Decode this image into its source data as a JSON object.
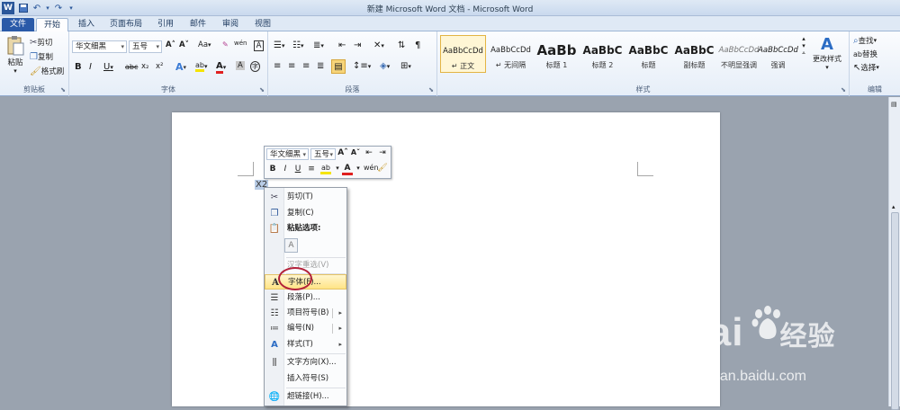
{
  "window": {
    "title": "新建 Microsoft Word 文档 - Microsoft Word"
  },
  "quick_access": {
    "icons": [
      "word-app-icon",
      "save-icon",
      "undo-icon",
      "redo-icon"
    ]
  },
  "tabs": [
    {
      "label": "文件"
    },
    {
      "label": "开始"
    },
    {
      "label": "插入"
    },
    {
      "label": "页面布局"
    },
    {
      "label": "引用"
    },
    {
      "label": "邮件"
    },
    {
      "label": "审阅"
    },
    {
      "label": "视图"
    }
  ],
  "ribbon": {
    "clipboard": {
      "group_label": "剪贴板",
      "paste": "粘贴",
      "cut": "剪切",
      "copy": "复制",
      "format_painter": "格式刷"
    },
    "font": {
      "group_label": "字体",
      "font_name": "华文细黑",
      "font_size": "五号",
      "bold": "B",
      "italic": "I",
      "underline": "U",
      "strike": "abc",
      "sub": "x₂",
      "sup": "x²",
      "grow": "A˄",
      "shrink": "A˅",
      "case": "Aa",
      "clear": "A",
      "phonetic": "wén",
      "border": "A",
      "effects": "A",
      "highlight": "ab",
      "color": "A",
      "shade": "A",
      "enclose": "字"
    },
    "paragraph": {
      "group_label": "段落"
    },
    "styles": {
      "group_label": "样式",
      "items": [
        {
          "preview": "AaBbCcDd",
          "name": "↵ 正文"
        },
        {
          "preview": "AaBbCcDd",
          "name": "↵ 无间隔"
        },
        {
          "preview": "AaBb",
          "name": "标题 1"
        },
        {
          "preview": "AaBbC",
          "name": "标题 2"
        },
        {
          "preview": "AaBbC",
          "name": "标题"
        },
        {
          "preview": "AaBbC",
          "name": "副标题"
        },
        {
          "preview": "AaBbCcDd",
          "name": "不明显强调"
        },
        {
          "preview": "AaBbCcDd",
          "name": "强调"
        }
      ],
      "change_styles": "更改样式"
    },
    "editing": {
      "group_label": "编辑",
      "find": "查找",
      "replace": "替换",
      "select": "选择"
    }
  },
  "document": {
    "selected_text": "X2"
  },
  "mini_toolbar": {
    "font_name": "华文细黑",
    "font_size": "五号"
  },
  "context_menu": {
    "items": [
      {
        "label": "剪切(T)",
        "icon": "scissors-icon"
      },
      {
        "label": "复制(C)",
        "icon": "copy-icon"
      },
      {
        "label": "粘贴选项:",
        "icon": "paste-icon"
      },
      {
        "label": "",
        "icon": "paste-keep-text-icon"
      },
      {
        "label": "汉字重选(V)",
        "icon": ""
      },
      {
        "label": "字体(F)...",
        "icon": "font-icon"
      },
      {
        "label": "段落(P)...",
        "icon": "paragraph-icon"
      },
      {
        "label": "项目符号(B)",
        "icon": "bullets-icon"
      },
      {
        "label": "编号(N)",
        "icon": "numbering-icon"
      },
      {
        "label": "样式(T)",
        "icon": "styles-icon"
      },
      {
        "label": "文字方向(X)...",
        "icon": "text-direction-icon"
      },
      {
        "label": "插入符号(S)",
        "icon": ""
      },
      {
        "label": "超链接(H)...",
        "icon": "hyperlink-icon"
      }
    ]
  },
  "watermark": {
    "brand": "Bai",
    "brand_suffix": "经验",
    "url": "jingyan.baidu.com"
  }
}
